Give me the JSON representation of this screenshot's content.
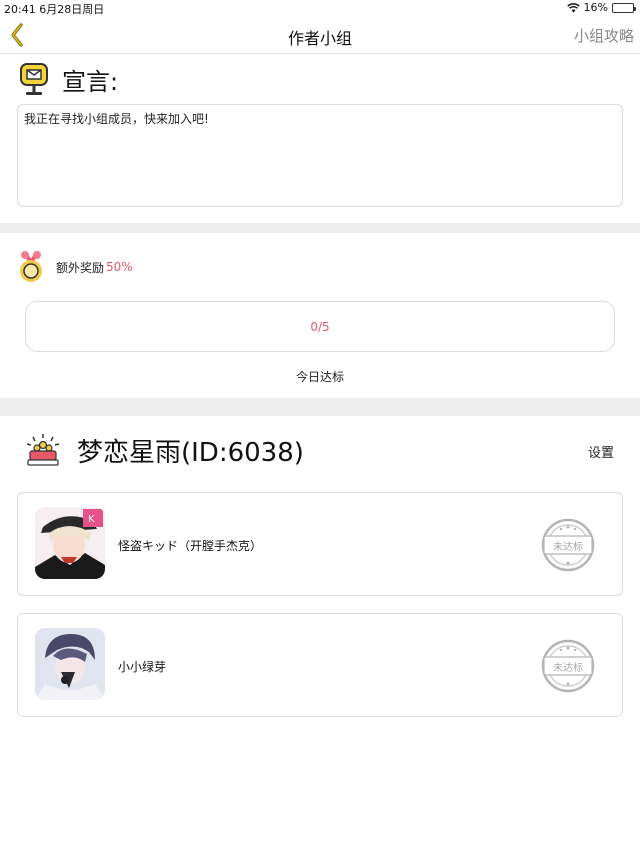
{
  "status_bar": {
    "time_date": "20:41   6月28日周日",
    "battery": "16%",
    "battery_level": 0.16
  },
  "nav": {
    "title": "作者小组",
    "right_link": "小组攻略"
  },
  "declaration": {
    "title": "宣言:",
    "text": "我正在寻找小组成员，快来加入吧!"
  },
  "reward": {
    "label": "额外奖励",
    "percent": "50%",
    "progress_text": "0/5",
    "progress_fraction": 0,
    "today_label": "今日达标"
  },
  "group": {
    "name": "梦恋星雨(ID:6038)",
    "settings": "设置"
  },
  "members": [
    {
      "name": "怪盗キッド（开膛手杰克）",
      "status": "未达标"
    },
    {
      "name": "小小绿芽",
      "status": "未达标"
    }
  ],
  "colors": {
    "accent_red": "#e35a6a",
    "divider": "#eeeeee",
    "stamp_gray": "#a8a8a8"
  }
}
